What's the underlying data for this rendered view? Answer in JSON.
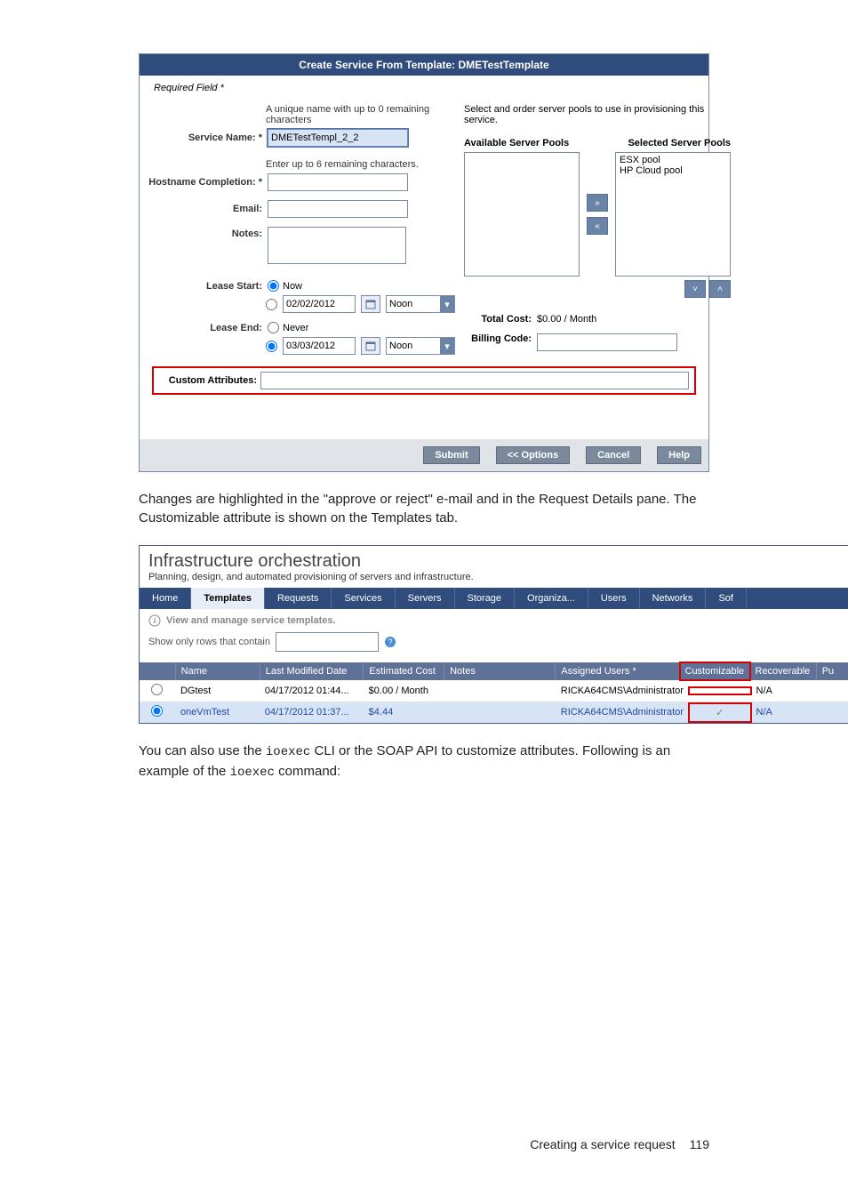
{
  "dialog": {
    "title": "Create Service From Template: DMETestTemplate",
    "required_line": "Required Field *",
    "service_name": {
      "hint": "A unique name with up to 0 remaining characters",
      "label": "Service Name: *",
      "value": "DMETestTempl_2_2"
    },
    "hostname": {
      "hint": "Enter up to 6 remaining characters.",
      "label": "Hostname Completion: *"
    },
    "email_label": "Email:",
    "notes_label": "Notes:",
    "lease_start": {
      "label": "Lease Start:",
      "now_label": "Now",
      "date": "02/02/2012",
      "time": "Noon"
    },
    "lease_end": {
      "label": "Lease End:",
      "never_label": "Never",
      "date": "03/03/2012",
      "time": "Noon"
    },
    "right_hint": "Select and order server pools to use in provisioning this service.",
    "available_label": "Available Server Pools",
    "selected_label": "Selected Server Pools",
    "selected_pools": [
      "ESX pool",
      "HP Cloud pool"
    ],
    "total_cost_label": "Total Cost:",
    "total_cost_value": "$0.00 / Month",
    "billing_label": "Billing Code:",
    "custom_label": "Custom Attributes:",
    "buttons": {
      "submit": "Submit",
      "options": "<< Options",
      "cancel": "Cancel",
      "help": "Help"
    }
  },
  "para1": "Changes are highlighted in the \"approve or reject\" e-mail and in the Request Details pane. The Customizable attribute is shown on the Templates tab.",
  "templates_page": {
    "title": "Infrastructure orchestration",
    "subtitle": "Planning, design, and automated provisioning of servers and infrastructure.",
    "tabs": [
      "Home",
      "Templates",
      "Requests",
      "Services",
      "Servers",
      "Storage",
      "Organiza...",
      "Users",
      "Networks",
      "Sof"
    ],
    "tip": "View and manage service templates.",
    "filter_label": "Show only rows that contain",
    "columns": [
      "Name",
      "Last Modified Date",
      "Estimated Cost",
      "Notes",
      "Assigned Users *",
      "Customizable",
      "Recoverable",
      "Pu"
    ],
    "rows": [
      {
        "selected": false,
        "name": "DGtest",
        "date": "04/17/2012 01:44...",
        "cost": "$0.00 / Month",
        "notes": "",
        "assigned": "RICKA64CMS\\Administrator",
        "customizable": "",
        "recoverable": "N/A"
      },
      {
        "selected": true,
        "name": "oneVmTest",
        "date": "04/17/2012 01:37...",
        "cost": "$4.44",
        "notes": "",
        "assigned": "RICKA64CMS\\Administrator",
        "customizable": "✓",
        "recoverable": "N/A"
      }
    ]
  },
  "para2_a": "You can also use the ",
  "para2_code1": "ioexec",
  "para2_b": " CLI or the SOAP API to customize attributes. Following is an example of the ",
  "para2_code2": "ioexec",
  "para2_c": " command:",
  "footer_text": "Creating a service request",
  "footer_page": "119"
}
